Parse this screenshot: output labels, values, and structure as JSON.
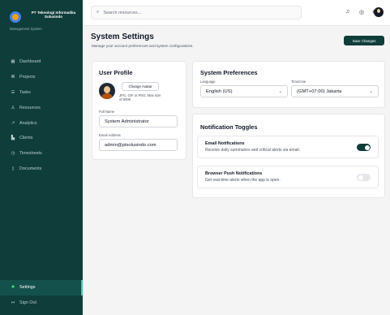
{
  "brand": {
    "name": "PT Teknologi Informatika Solusindo",
    "subtitle": "Management System"
  },
  "nav": {
    "items": [
      {
        "label": "Dashboard",
        "icon": "dashboard-icon"
      },
      {
        "label": "Projects",
        "icon": "projects-icon"
      },
      {
        "label": "Tasks",
        "icon": "tasks-icon"
      },
      {
        "label": "Resources",
        "icon": "resources-icon"
      },
      {
        "label": "Analytics",
        "icon": "analytics-icon"
      },
      {
        "label": "Clients",
        "icon": "clients-icon"
      },
      {
        "label": "Timesheets",
        "icon": "clock-icon"
      },
      {
        "label": "Documents",
        "icon": "document-icon"
      }
    ],
    "settings_label": "Settings",
    "signout_label": "Sign Out",
    "active": "Settings"
  },
  "topbar": {
    "search_placeholder": "Search resources..."
  },
  "header": {
    "title": "System Settings",
    "subtitle": "Manage your account preferences and system configurations.",
    "save_label": "Save Changes"
  },
  "profile": {
    "title": "User Profile",
    "change_avatar_label": "Change Avatar",
    "avatar_hint": "JPG, GIF or PNG. Max size of 800K",
    "full_name_label": "Full Name",
    "full_name_value": "System Administrator",
    "email_label": "Email Address",
    "email_value": "admin@ptsolusindo.com"
  },
  "preferences": {
    "title": "System Preferences",
    "language_label": "Language",
    "language_value": "English (US)",
    "timezone_label": "Timezone",
    "timezone_value": "(GMT+07:00) Jakarta"
  },
  "notifications": {
    "title": "Notification Toggles",
    "items": [
      {
        "title": "Email Notifications",
        "description": "Receive daily summaries and critical alerts via email.",
        "enabled": true
      },
      {
        "title": "Browser Push Notifications",
        "description": "Get real-time alerts when the app is open.",
        "enabled": false
      }
    ]
  },
  "colors": {
    "sidebar": "#0f3d3a",
    "accent": "#0f3d3a",
    "active_indicator": "#34d399"
  }
}
